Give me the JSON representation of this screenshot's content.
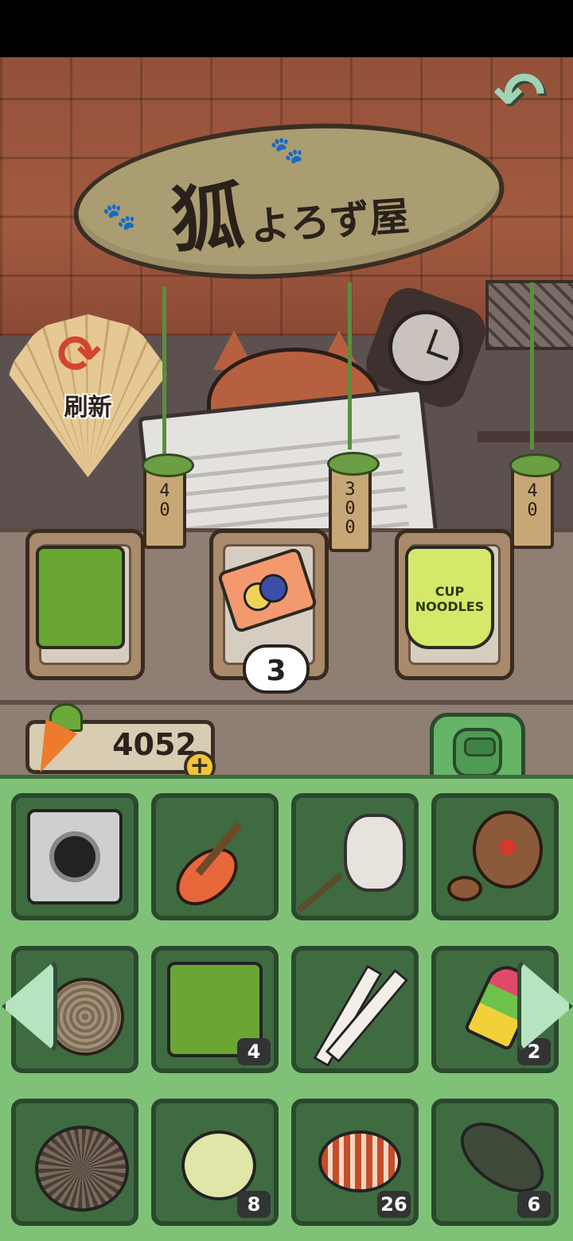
{
  "shop": {
    "sign_main": "狐",
    "sign_sub": "よろず屋",
    "refresh_label": "刷新",
    "items": [
      {
        "name": "carrot-snack-bag",
        "price": "40"
      },
      {
        "name": "coupon-ticket",
        "price": "300",
        "quantity": "3"
      },
      {
        "name": "cup-noodles",
        "price": "40",
        "label": "CUP NOODLES"
      }
    ]
  },
  "wallet": {
    "carrots": "4052",
    "add_label": "+"
  },
  "inventory": {
    "slots": [
      {
        "name": "instant-camera",
        "count": ""
      },
      {
        "name": "ukulele",
        "count": ""
      },
      {
        "name": "bug-net",
        "count": ""
      },
      {
        "name": "paddle-ball",
        "count": ""
      },
      {
        "name": "yarn-rope",
        "count": ""
      },
      {
        "name": "carrot-snack-bag",
        "count": "4"
      },
      {
        "name": "ski-set",
        "count": ""
      },
      {
        "name": "popsicle",
        "count": "2"
      },
      {
        "name": "sea-urchin",
        "count": ""
      },
      {
        "name": "pufferfish",
        "count": "8"
      },
      {
        "name": "lionfish",
        "count": "26"
      },
      {
        "name": "catfish",
        "count": "6"
      }
    ]
  },
  "colors": {
    "accent_green": "#7fc277",
    "slot_bg": "#3f6b41",
    "roof": "#a25a3f",
    "carrot": "#ec7b2c"
  }
}
